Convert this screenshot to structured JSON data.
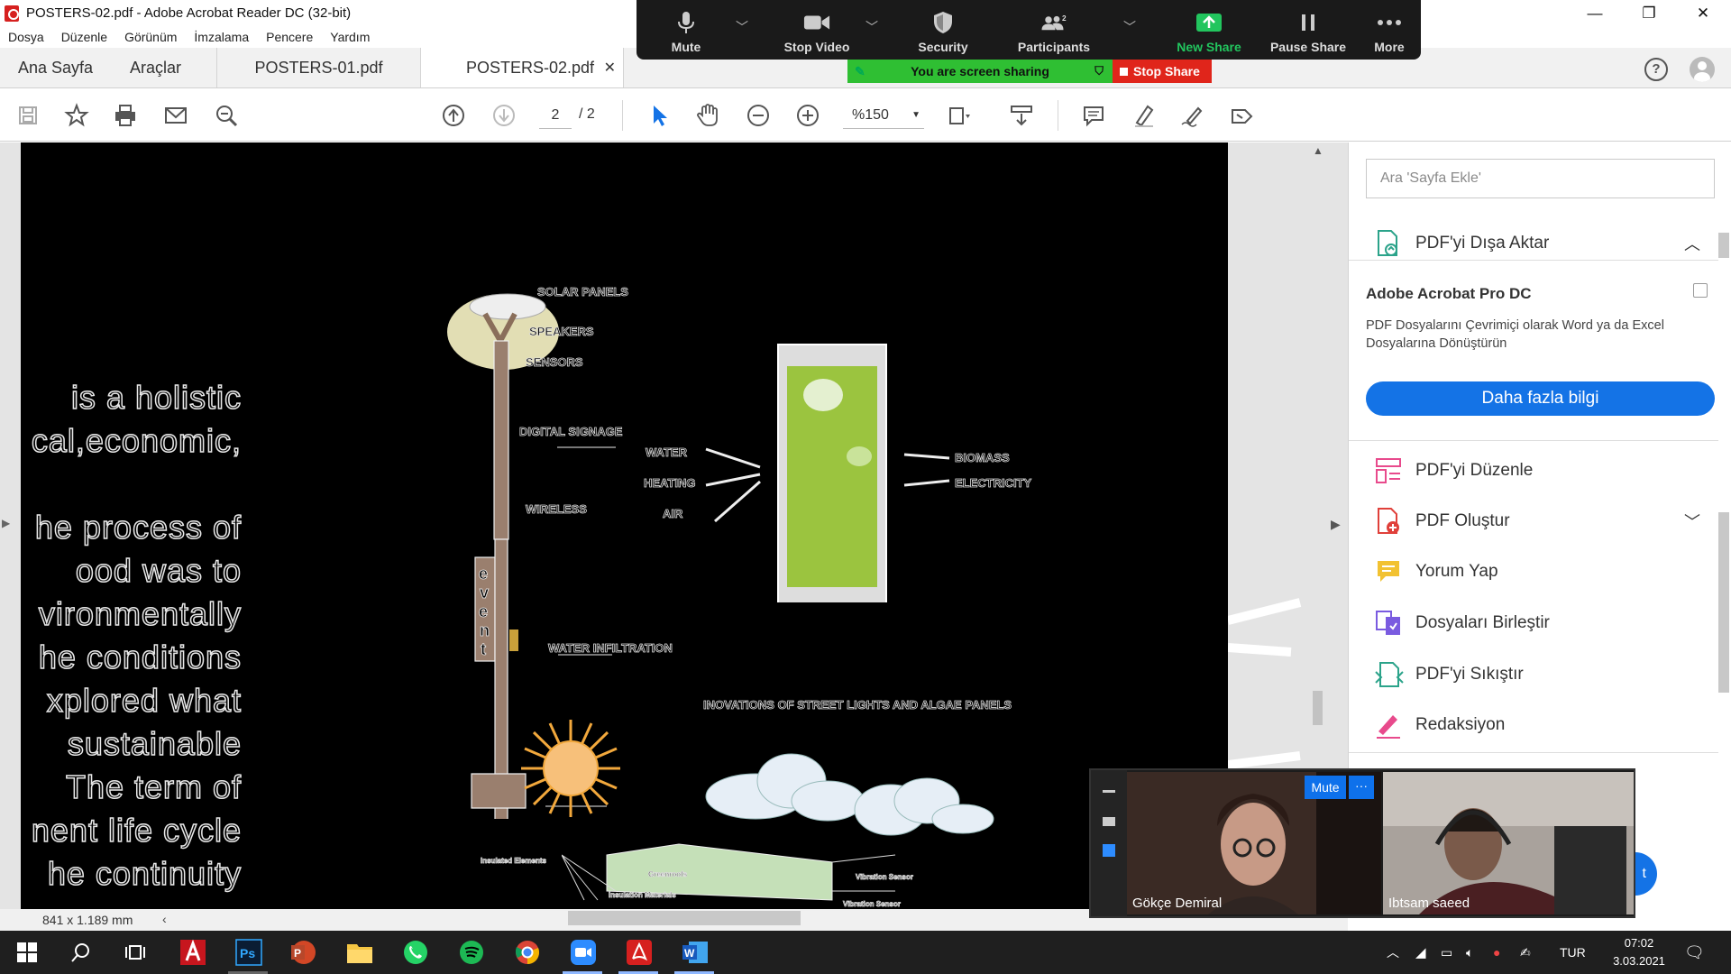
{
  "window": {
    "title": "POSTERS-02.pdf - Adobe Acrobat Reader DC (32-bit)",
    "minimize": "—",
    "maximize": "❐",
    "close": "✕"
  },
  "menu": [
    "Dosya",
    "Düzenle",
    "Görünüm",
    "İmzalama",
    "Pencere",
    "Yardım"
  ],
  "tabs": {
    "home": "Ana Sayfa",
    "tools": "Araçlar",
    "doc1": "POSTERS-01.pdf",
    "doc2": "POSTERS-02.pdf",
    "close": "✕"
  },
  "toolbar": {
    "page_current": "2",
    "page_total": "/ 2",
    "zoom": "%150"
  },
  "document": {
    "left_text": [
      "is a holistic",
      "cal,economic,",
      "",
      "he process of",
      "ood was to",
      "vironmentally",
      "he conditions",
      "xplored what",
      "sustainable",
      "The term of",
      "nent life cycle",
      "he continuity"
    ],
    "labels": {
      "solar": "SOLAR PANELS",
      "speakers": "SPEAKERS",
      "sensors": "SENSORS",
      "signage": "DIGITAL SIGNAGE",
      "wireless": "WIRELESS",
      "infiltration": "WATER INFILTRATION",
      "water": "WATER",
      "heating": "HEATING",
      "air": "AIR",
      "biomass": "BIOMASS",
      "electricity": "ELECTRICITY",
      "caption": "INOVATIONS OF STREET LIGHTS AND ALGAE PANELS",
      "event": "event",
      "roof_left": "Insulated Elements",
      "roof_mid": "Greenroofs",
      "roof_bottom": "Insulation Materials",
      "roof_right1": "Vibration Sensor",
      "roof_right2": "Vibration Sensor"
    }
  },
  "statusbar": {
    "dimensions": "841 x 1.189 mm"
  },
  "rightpane": {
    "search_placeholder": "Ara 'Sayfa Ekle'",
    "export": "PDF'yi Dışa Aktar",
    "promo_title": "Adobe Acrobat Pro DC",
    "promo_text": "PDF Dosyalarını Çevrimiçi olarak Word ya da Excel Dosyalarına Dönüştürün",
    "promo_button": "Daha fazla bilgi",
    "items": [
      "PDF'yi Düzenle",
      "PDF Oluştur",
      "Yorum Yap",
      "Dosyaları Birleştir",
      "PDF'yi Sıkıştır",
      "Redaksiyon"
    ]
  },
  "zoom_bar": {
    "mute": "Mute",
    "stop_video": "Stop Video",
    "security": "Security",
    "participants": "Participants",
    "participants_count": "2",
    "new_share": "New Share",
    "pause_share": "Pause Share",
    "more": "More",
    "banner": "You are screen sharing",
    "stop_share": "Stop Share"
  },
  "video": {
    "mute": "Mute",
    "more": "···",
    "name1": "Gökçe Demiral",
    "name2": "Ibtsam saeed",
    "behind_button": "t"
  },
  "taskbar": {
    "lang": "TUR",
    "time": "07:02",
    "date": "3.03.2021"
  },
  "colors": {
    "accent": "#1473e6",
    "zoom_green": "#2fbf33",
    "stop_red": "#e0251b"
  }
}
